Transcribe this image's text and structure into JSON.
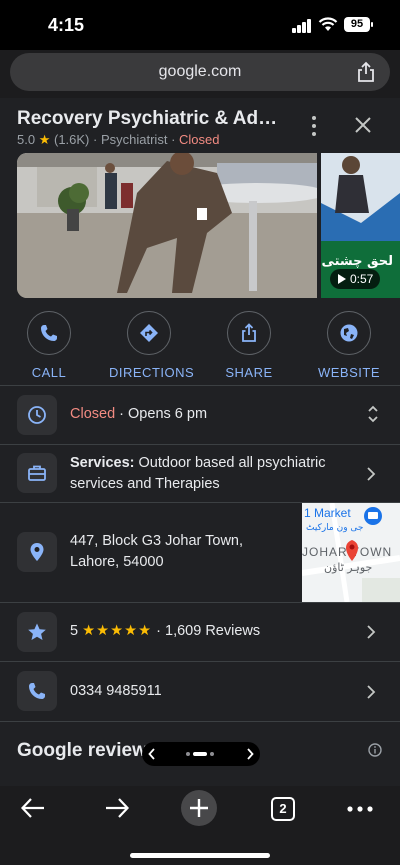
{
  "status_bar": {
    "time": "4:15",
    "battery": "95"
  },
  "browser": {
    "url": "google.com",
    "tab_count": "2"
  },
  "place": {
    "name": "Recovery Psychiatric & Addi...",
    "rating": "5.0",
    "review_count_short": "(1.6K)",
    "category": "Psychiatrist",
    "status": "Closed",
    "video_duration": "0:57",
    "sign_text": "لحق چشتی"
  },
  "actions": [
    {
      "label": "CALL",
      "icon": "phone-icon"
    },
    {
      "label": "DIRECTIONS",
      "icon": "directions-icon"
    },
    {
      "label": "SHARE",
      "icon": "share-icon"
    },
    {
      "label": "WEBSITE",
      "icon": "globe-icon"
    }
  ],
  "hours": {
    "status": "Closed",
    "separator": " · ",
    "opens": "Opens 6 pm"
  },
  "services": {
    "label": "Services:",
    "text": "Outdoor based all psychiatric services and Therapies"
  },
  "address": {
    "line1": "447, Block G3 Johar Town,",
    "line2": "Lahore, 54000"
  },
  "map_thumb": {
    "market": "1 Market",
    "market_urdu": "جی ون مارکیٹ",
    "area": "JOHAR TOWN",
    "area_urdu": "جوہر ٹاؤن"
  },
  "reviews_row": {
    "rating": "5",
    "stars": "★★★★★",
    "separator": "·",
    "count": "1,609 Reviews"
  },
  "phone": {
    "number": "0334 9485911"
  },
  "review_summary": {
    "title": "Google review summary"
  },
  "colors": {
    "panel": "#202124",
    "accent": "#8ab4f8",
    "closed": "#f28b82",
    "star": "#fbbc04"
  }
}
